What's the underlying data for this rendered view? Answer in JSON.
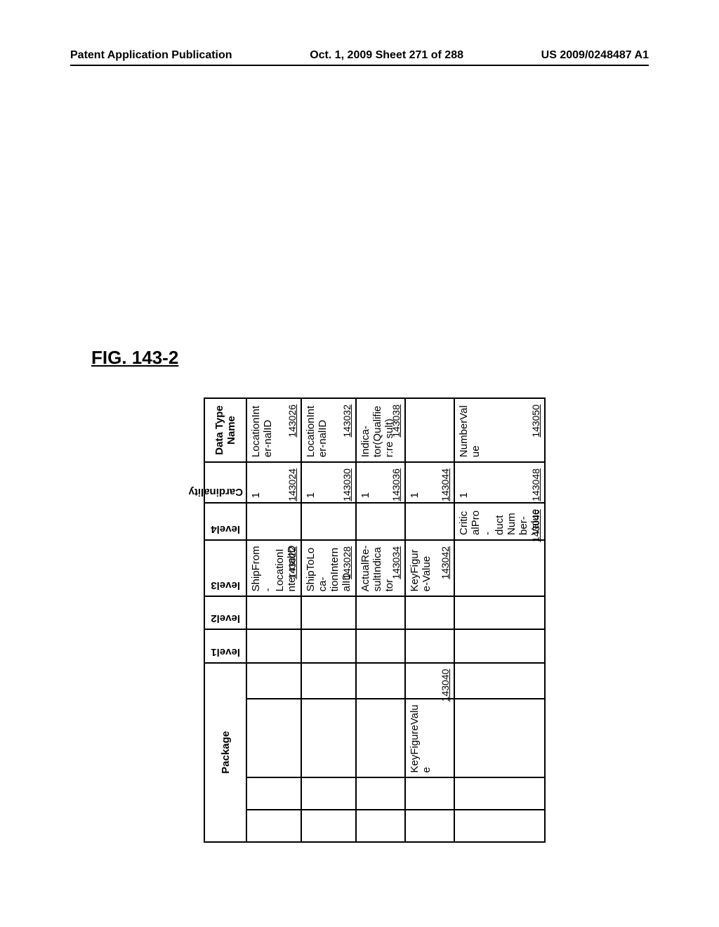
{
  "header": {
    "left": "Patent Application Publication",
    "center": "Oct. 1, 2009  Sheet 271 of 288",
    "right": "US 2009/0248487 A1"
  },
  "figure_label": "FIG. 143-2",
  "columns": {
    "package": "Package",
    "level1": "level1",
    "level2": "level2",
    "level3": "level3",
    "level4": "level4",
    "cardinality": "Cardinality",
    "datatype": "Data Type Name"
  },
  "rows": [
    {
      "package_a": "",
      "package_b": "",
      "package_c": "",
      "package_ref": "",
      "level1": "",
      "level2": "",
      "level3": "ShipFrom-LocationInter-nalID",
      "level3_ref": "143022",
      "level4": "",
      "level4_ref": "",
      "card": "1",
      "card_ref": "143024",
      "dtype": "LocationInter-nalID",
      "dtype_ref": "143026"
    },
    {
      "package_a": "",
      "package_b": "",
      "package_c": "",
      "package_ref": "",
      "level1": "",
      "level2": "",
      "level3": "ShipToLoca-tionInternalID",
      "level3_ref": "143028",
      "level4": "",
      "level4_ref": "",
      "card": "1",
      "card_ref": "143030",
      "dtype": "LocationInter-nalID",
      "dtype_ref": "143032"
    },
    {
      "package_a": "",
      "package_b": "",
      "package_c": "",
      "package_ref": "",
      "level1": "",
      "level2": "",
      "level3": "ActualRe-sultIndicator",
      "level3_ref": "143034",
      "level4": "",
      "level4_ref": "",
      "card": "1",
      "card_ref": "143036",
      "dtype": "Indica-tor(Qualifier:re sult)",
      "dtype_ref": "143038"
    },
    {
      "package_a": "",
      "package_b": "",
      "package_c": "KeyFigureValue",
      "package_ref": "143040",
      "level1": "",
      "level2": "",
      "level3": "KeyFigure-Value",
      "level3_ref": "143042",
      "level4": "",
      "level4_ref": "",
      "card": "1",
      "card_ref": "143044",
      "dtype": "",
      "dtype_ref": ""
    },
    {
      "package_a": "",
      "package_b": "",
      "package_c": "",
      "package_ref": "",
      "level1": "",
      "level2": "",
      "level3": "",
      "level3_ref": "",
      "level4": "CriticalPro-ductNumber-Value",
      "level4_ref": "143046",
      "card": "1",
      "card_ref": "143048",
      "dtype": "NumberValue",
      "dtype_ref": "143050"
    }
  ]
}
